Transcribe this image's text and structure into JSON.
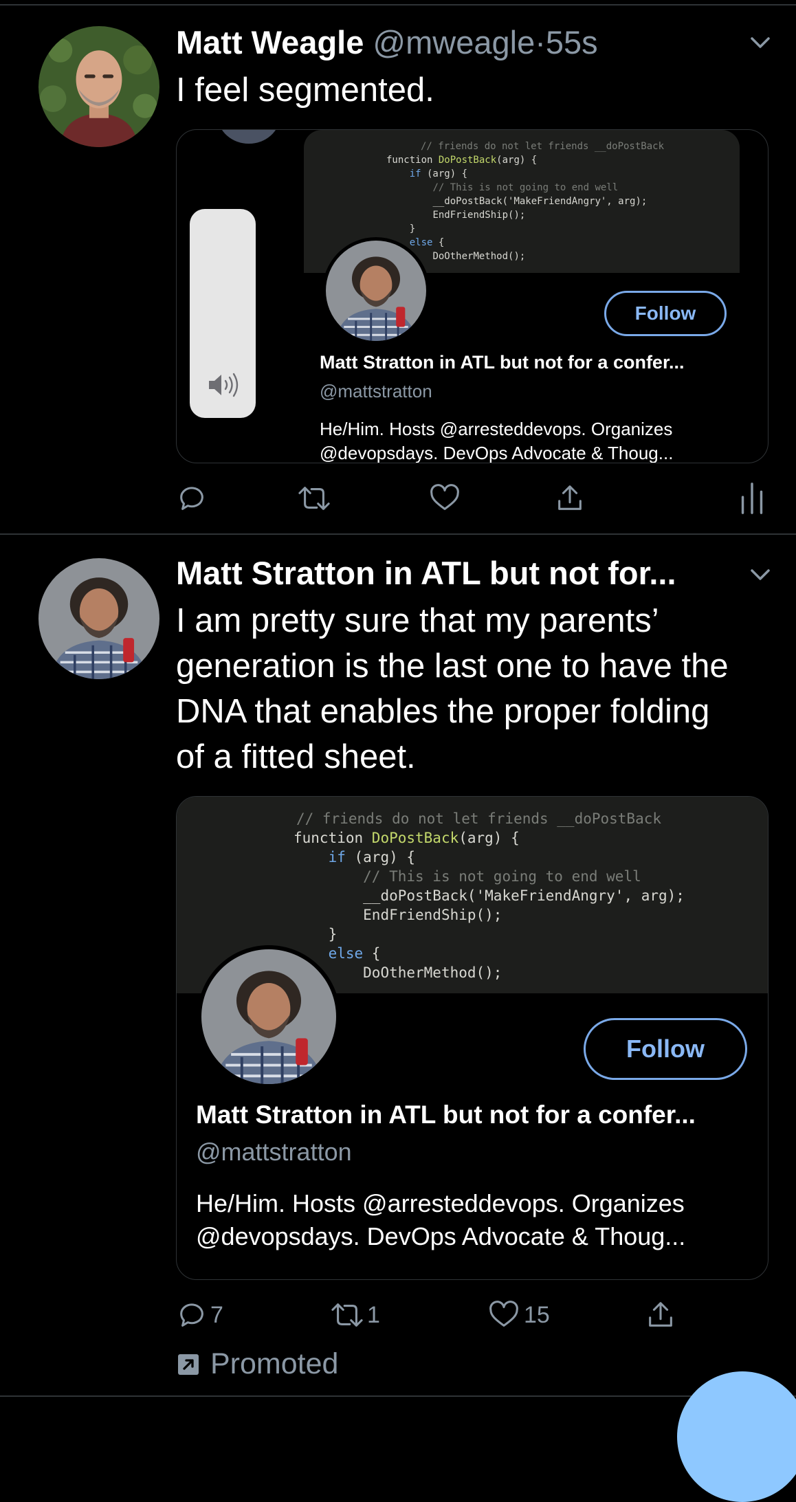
{
  "tweets": [
    {
      "author_name": "Matt Weagle",
      "author_handle": "@mweagle",
      "separator": "·",
      "time": "55s",
      "text": "I feel segmented.",
      "card": {
        "follow_label": "Follow",
        "name": "Matt Stratton in ATL but not for a confer...",
        "handle": "@mattstratton",
        "bio_line1": "He/Him. Hosts @arresteddevops. Organizes",
        "bio_line2": "@devopsdays. DevOps Advocate & Thoug..."
      },
      "actions": {
        "reply_count": "",
        "retweet_count": "",
        "like_count": ""
      }
    },
    {
      "author_name": "Matt Stratton in ATL but not for...",
      "text_lines": [
        "I am pretty sure that my parents’",
        "generation is the last one to have the",
        "DNA that enables the proper folding",
        "of a fitted sheet."
      ],
      "card": {
        "follow_label": "Follow",
        "name": "Matt Stratton in ATL but not for a confer...",
        "handle": "@mattstratton",
        "bio_line1": "He/Him. Hosts @arresteddevops. Organizes",
        "bio_line2": "@devopsdays. DevOps Advocate & Thoug..."
      },
      "actions": {
        "reply_count": "7",
        "retweet_count": "1",
        "like_count": "15"
      },
      "promoted_label": "Promoted"
    }
  ],
  "code_snippet": {
    "line0": "// friends do not let friends __doPostBack",
    "line1_a": "function ",
    "line1_b": "DoPostBack",
    "line1_c": "(arg) {",
    "line2_a": "if",
    "line2_b": " (arg) {",
    "line3": "// This is not going to end well",
    "line4": "__doPostBack('MakeFriendAngry', arg);",
    "line5": "EndFriendShip();",
    "line6": "}",
    "line7_a": "else",
    "line7_b": " {",
    "line8": "DoOtherMethod();",
    "line9": "}"
  },
  "colors": {
    "background": "#000000",
    "secondary_text": "#8b98a5",
    "follow_accent": "#8ab8f5",
    "divider": "#2f3336",
    "fab": "#8ec8ff"
  },
  "icons": {
    "more": "chevron-down-icon",
    "reply": "reply-icon",
    "retweet": "retweet-icon",
    "like": "heart-icon",
    "share": "share-icon",
    "analytics": "analytics-icon",
    "promoted": "promoted-icon",
    "volume": "speaker-icon"
  }
}
